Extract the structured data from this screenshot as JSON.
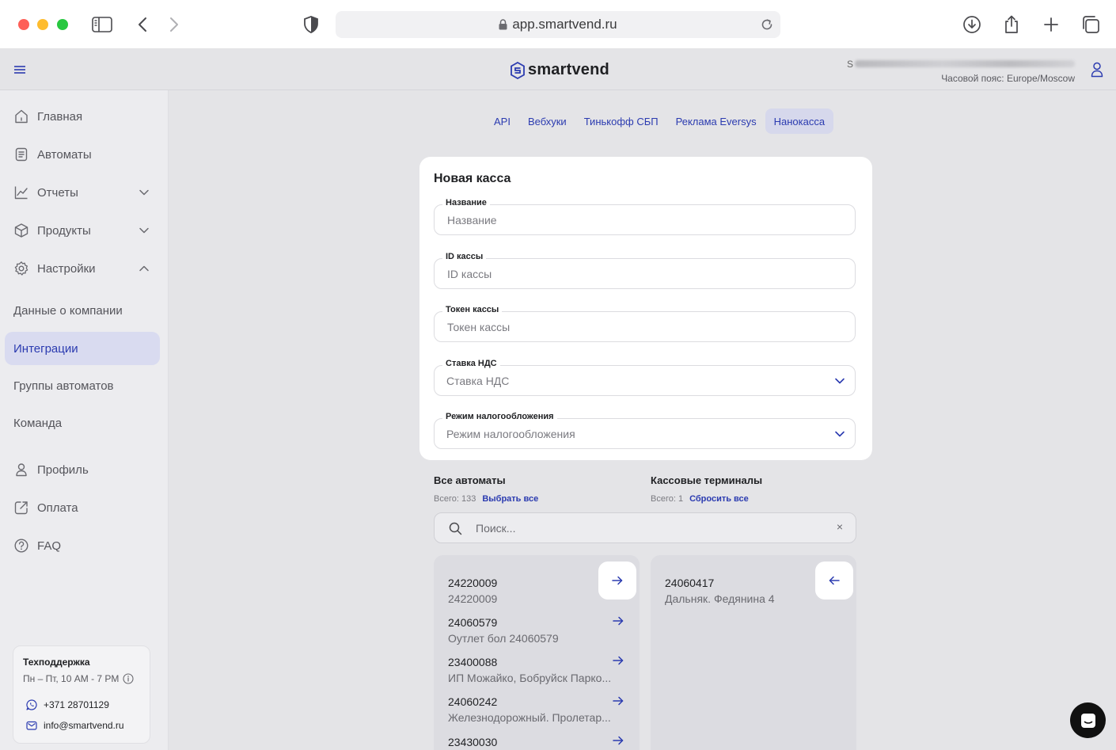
{
  "browser": {
    "url": "app.smartvend.ru"
  },
  "header": {
    "brand": "smartvend",
    "user_name_prefix": "S",
    "timezone": "Часовой пояс: Europe/Moscow"
  },
  "sidebar": {
    "items": [
      {
        "label": "Главная",
        "icon": "home-icon"
      },
      {
        "label": "Автоматы",
        "icon": "list-icon"
      },
      {
        "label": "Отчеты",
        "icon": "chart-icon"
      },
      {
        "label": "Продукты",
        "icon": "box-icon"
      },
      {
        "label": "Настройки",
        "icon": "gear-icon"
      }
    ],
    "settings_sub": [
      {
        "label": "Данные о компании"
      },
      {
        "label": "Интеграции",
        "active": true
      },
      {
        "label": "Группы автоматов"
      },
      {
        "label": "Команда"
      }
    ],
    "bottom": [
      {
        "label": "Профиль",
        "icon": "user-icon"
      },
      {
        "label": "Оплата",
        "icon": "external-link-icon"
      },
      {
        "label": "FAQ",
        "icon": "help-icon"
      }
    ],
    "support": {
      "title": "Техподдержка",
      "hours": "Пн – Пт, 10 AM - 7 PM",
      "phone": "+371 28701129",
      "email": "info@smartvend.ru"
    }
  },
  "tabs": [
    {
      "label": "API"
    },
    {
      "label": "Вебхуки"
    },
    {
      "label": "Тинькофф СБП"
    },
    {
      "label": "Реклама Eversys"
    },
    {
      "label": "Нанокасса",
      "active": true
    }
  ],
  "form": {
    "title": "Новая касса",
    "fields": [
      {
        "label": "Название",
        "placeholder": "Название"
      },
      {
        "label": "ID кассы",
        "placeholder": "ID кассы"
      },
      {
        "label": "Токен кассы",
        "placeholder": "Токен кассы"
      },
      {
        "label": "Ставка НДС",
        "placeholder": "Ставка НДС"
      },
      {
        "label": "Режим налогообложения",
        "placeholder": "Режим налогообложения"
      }
    ]
  },
  "lists": {
    "left_title": "Все автоматы",
    "left_count": "Всего: 133",
    "left_action": "Выбрать все",
    "right_title": "Кассовые терминалы",
    "right_count": "Всего: 1",
    "right_action": "Сбросить все",
    "search_placeholder": "Поиск...",
    "search_clear": "×",
    "left_items": [
      {
        "id": "24220009",
        "name": "24220009"
      },
      {
        "id": "24060579",
        "name": "Оутлет бол 24060579"
      },
      {
        "id": "23400088",
        "name": "ИП Можайко, Бобруйск Парко..."
      },
      {
        "id": "24060242",
        "name": "Железнодорожный. Пролетар..."
      },
      {
        "id": "23430030",
        "name": ""
      }
    ],
    "right_items": [
      {
        "id": "24060417",
        "name": "Дальняк. Федянина 4"
      }
    ]
  },
  "colors": {
    "accent": "#2b3bb0",
    "active_bg": "#d9dbf0"
  }
}
